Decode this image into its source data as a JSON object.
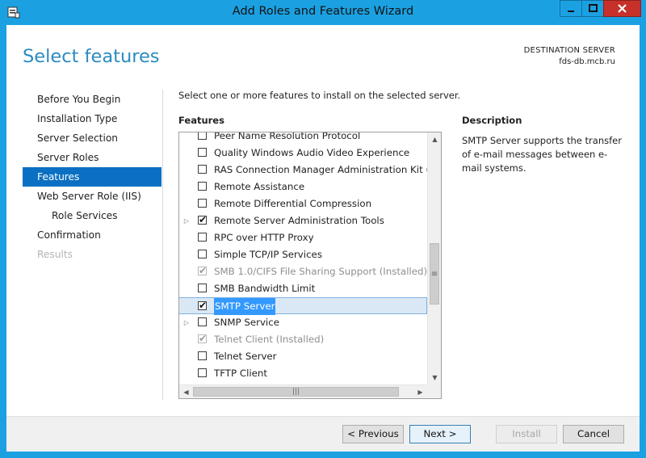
{
  "window": {
    "title": "Add Roles and Features Wizard",
    "accent": "#1ba1e2"
  },
  "header": {
    "title": "Select features",
    "destination_label": "DESTINATION SERVER",
    "destination_server": "fds-db.mcb.ru"
  },
  "nav": {
    "items": [
      {
        "label": "Before You Begin",
        "state": "normal"
      },
      {
        "label": "Installation Type",
        "state": "normal"
      },
      {
        "label": "Server Selection",
        "state": "normal"
      },
      {
        "label": "Server Roles",
        "state": "normal"
      },
      {
        "label": "Features",
        "state": "active"
      },
      {
        "label": "Web Server Role (IIS)",
        "state": "normal"
      },
      {
        "label": "Role Services",
        "state": "sub"
      },
      {
        "label": "Confirmation",
        "state": "normal"
      },
      {
        "label": "Results",
        "state": "disabled"
      }
    ]
  },
  "main": {
    "instruction": "Select one or more features to install on the selected server.",
    "features_label": "Features",
    "description_label": "Description",
    "description_text": "SMTP Server supports the transfer of e-mail messages between e-mail systems."
  },
  "features": [
    {
      "label": "Peer Name Resolution Protocol",
      "checked": false,
      "disabled": false,
      "expandable": false
    },
    {
      "label": "Quality Windows Audio Video Experience",
      "checked": false,
      "disabled": false,
      "expandable": false
    },
    {
      "label": "RAS Connection Manager Administration Kit (CMA",
      "checked": false,
      "disabled": false,
      "expandable": false
    },
    {
      "label": "Remote Assistance",
      "checked": false,
      "disabled": false,
      "expandable": false
    },
    {
      "label": "Remote Differential Compression",
      "checked": false,
      "disabled": false,
      "expandable": false
    },
    {
      "label": "Remote Server Administration Tools",
      "checked": true,
      "disabled": false,
      "expandable": true
    },
    {
      "label": "RPC over HTTP Proxy",
      "checked": false,
      "disabled": false,
      "expandable": false
    },
    {
      "label": "Simple TCP/IP Services",
      "checked": false,
      "disabled": false,
      "expandable": false
    },
    {
      "label": "SMB 1.0/CIFS File Sharing Support (Installed)",
      "checked": true,
      "disabled": true,
      "expandable": false
    },
    {
      "label": "SMB Bandwidth Limit",
      "checked": false,
      "disabled": false,
      "expandable": false
    },
    {
      "label": "SMTP Server",
      "checked": true,
      "disabled": false,
      "expandable": false,
      "selected": true
    },
    {
      "label": "SNMP Service",
      "checked": false,
      "disabled": false,
      "expandable": true
    },
    {
      "label": "Telnet Client (Installed)",
      "checked": true,
      "disabled": true,
      "expandable": false
    },
    {
      "label": "Telnet Server",
      "checked": false,
      "disabled": false,
      "expandable": false
    },
    {
      "label": "TFTP Client",
      "checked": false,
      "disabled": false,
      "expandable": false
    }
  ],
  "buttons": {
    "previous": "< Previous",
    "next": "Next >",
    "install": "Install",
    "cancel": "Cancel"
  }
}
